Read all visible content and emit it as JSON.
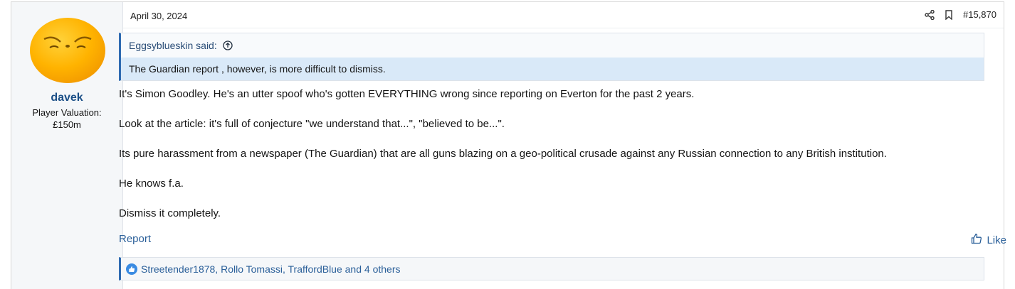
{
  "user": {
    "name": "davek",
    "title_line1": "Player Valuation:",
    "title_line2": "£150m",
    "avatar_icon": "orange-avatar-icon"
  },
  "post": {
    "date": "April 30, 2024",
    "number": "#15,870",
    "quote": {
      "author": "Eggsyblueskin said:",
      "text": "The Guardian report , however, is more difficult to dismiss."
    },
    "paragraphs": [
      "It's Simon Goodley. He's an utter spoof who's gotten EVERYTHING wrong since reporting on Everton for the past 2 years.",
      "Look at the article: it's full of conjecture \"we understand that...\", \"believed to be...\".",
      "Its pure harassment from a newspaper (The Guardian) that are all guns blazing on a geo-political crusade against any Russian connection to any British institution.",
      "He knows f.a.",
      "Dismiss it completely."
    ],
    "report_label": "Report",
    "like_label": "Like",
    "reactions_text": "Streetender1878, Rollo Tomassi, TraffordBlue and 4 others"
  },
  "colors": {
    "accent": "#2e6ab1",
    "link": "#2a5f99",
    "quote_highlight": "#d9e9f8",
    "username": "#1b4f87"
  }
}
